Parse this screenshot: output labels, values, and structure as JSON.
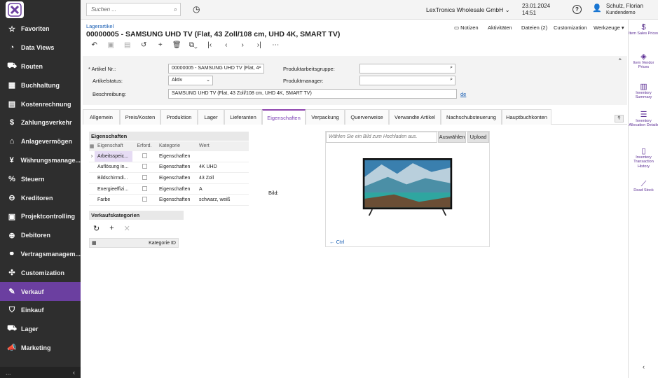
{
  "sidebar": {
    "items": [
      {
        "icon": "star-icon",
        "glyph": "☆",
        "label": "Favoriten"
      },
      {
        "icon": "chart-icon",
        "glyph": "◔",
        "label": "Data Views"
      },
      {
        "icon": "truck-icon",
        "glyph": "⛟",
        "label": "Routen"
      },
      {
        "icon": "calculator-icon",
        "glyph": "▦",
        "label": "Buchhaltung"
      },
      {
        "icon": "cost-icon",
        "glyph": "▤",
        "label": "Kostenrechnung"
      },
      {
        "icon": "dollar-icon",
        "glyph": "$",
        "label": "Zahlungsverkehr"
      },
      {
        "icon": "assets-icon",
        "glyph": "⌂",
        "label": "Anlagevermögen"
      },
      {
        "icon": "currency-icon",
        "glyph": "¥",
        "label": "Währungsmanage..."
      },
      {
        "icon": "percent-icon",
        "glyph": "%",
        "label": "Steuern"
      },
      {
        "icon": "minus-circle-icon",
        "glyph": "⊖",
        "label": "Kreditoren"
      },
      {
        "icon": "project-icon",
        "glyph": "▣",
        "label": "Projektcontrolling"
      },
      {
        "icon": "plus-circle-icon",
        "glyph": "⊕",
        "label": "Debitoren"
      },
      {
        "icon": "handshake-icon",
        "glyph": "⚭",
        "label": "Vertragsmanagem..."
      },
      {
        "icon": "puzzle-icon",
        "glyph": "✣",
        "label": "Customization"
      },
      {
        "icon": "edit-icon",
        "glyph": "✎",
        "label": "Verkauf"
      },
      {
        "icon": "cart-icon",
        "glyph": "⛉",
        "label": "Einkauf"
      },
      {
        "icon": "truck-icon",
        "glyph": "⛟",
        "label": "Lager"
      },
      {
        "icon": "megaphone-icon",
        "glyph": "📣",
        "label": "Marketing"
      }
    ],
    "bottom_more": "...",
    "bottom_collapse": "‹"
  },
  "topbar": {
    "search_placeholder": "Suchen ...",
    "company": "LexTronics Wholesale GmbH",
    "date": "23.01.2024",
    "time": "14:51",
    "user": "Schulz, Florian",
    "user_sub": "Kundendemo"
  },
  "header": {
    "breadcrumb": "Lagerartikel",
    "title": "00000005 - SAMSUNG UHD TV (Flat, 43 Zoll/108 cm, UHD 4K, SMART TV)",
    "actions": [
      "Notizen",
      "Aktivitäten",
      "Dateien (2)",
      "Customization",
      "Werkzeuge"
    ]
  },
  "form": {
    "artikel_label": "Artikel Nr.:",
    "artikel_value": "00000005 - SAMSUNG UHD TV (Flat, 4",
    "status_label": "Artikelstatus:",
    "status_value": "Aktiv",
    "beschreibung_label": "Beschreibung:",
    "beschreibung_value": "SAMSUNG UHD TV (Flat, 43 Zoll/108 cm, UHD 4K, SMART TV)",
    "lang": "de",
    "produktgruppe_label": "Produktarbeitsgruppe:",
    "produktmanager_label": "Produktmanager:"
  },
  "tabs": [
    "Allgemein",
    "Preis/Kosten",
    "Produktion",
    "Lager",
    "Lieferanten",
    "Eigenschaften",
    "Verpackung",
    "Querverweise",
    "Verwandte Artikel",
    "Nachschubsteuerung",
    "Hauptbuchkonten"
  ],
  "active_tab": "Eigenschaften",
  "eigenschaften": {
    "title": "Eigenschaften",
    "headers": [
      "Eigenschaft",
      "Erford.",
      "Kategorie",
      "Wert"
    ],
    "rows": [
      {
        "eigenschaft": "Arbeitsspeic...",
        "kategorie": "Eigenschaften",
        "wert": ""
      },
      {
        "eigenschaft": "Auflösung in...",
        "kategorie": "Eigenschaften",
        "wert": "4K UHD"
      },
      {
        "eigenschaft": "Bildschirmdi...",
        "kategorie": "Eigenschaften",
        "wert": "43 Zoll"
      },
      {
        "eigenschaft": "Energieeffizi...",
        "kategorie": "Eigenschaften",
        "wert": "A"
      },
      {
        "eigenschaft": "Farbe",
        "kategorie": "Eigenschaften",
        "wert": "schwarz, weiß"
      }
    ]
  },
  "verkauf": {
    "title": "Verkaufskategorien",
    "col": "Kategorie ID"
  },
  "bild": {
    "label": "Bild:",
    "placeholder": "Wählen Sie ein Bild zum Hochladen aus.",
    "select_btn": "Auswählen",
    "upload_btn": "Upload",
    "ctrl": "← Ctrl"
  },
  "right_panel": [
    {
      "icon": "dollar-icon",
      "glyph": "$",
      "label": "Item Sales Prices"
    },
    {
      "icon": "tag-icon",
      "glyph": "◈",
      "label": "Item Vendor Prices"
    },
    {
      "icon": "building-icon",
      "glyph": "▥",
      "label": "Inventory Summary"
    },
    {
      "icon": "list-icon",
      "glyph": "☰",
      "label": "Inventory Allocation Details"
    },
    {
      "icon": "doc-icon",
      "glyph": "▯",
      "label": "Inventory Transaction History"
    },
    {
      "icon": "chart-icon",
      "glyph": "⟋",
      "label": "Dead Stock"
    }
  ],
  "colors": {
    "sidebar": "#2e2e2e",
    "active": "#6b3fa0",
    "accent": "#8e44ad"
  }
}
